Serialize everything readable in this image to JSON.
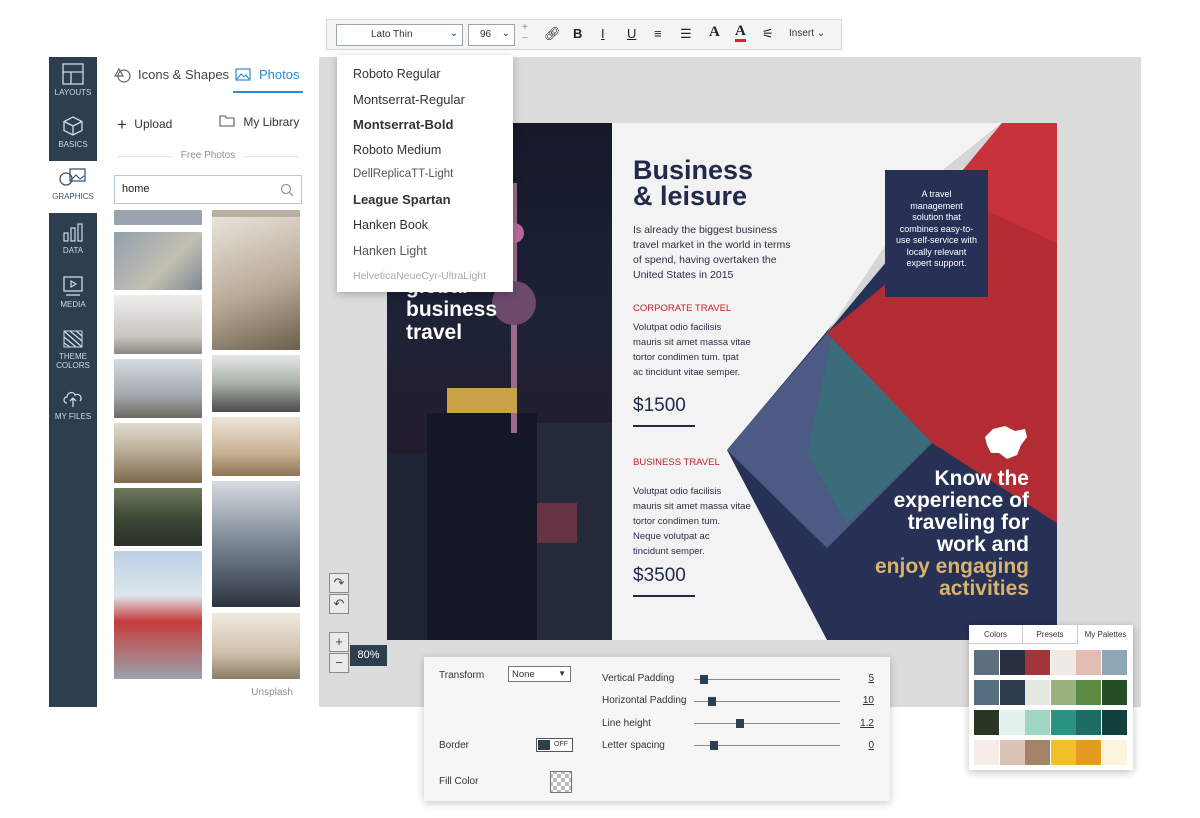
{
  "sidebar": {
    "items": [
      {
        "label": "LAYOUTS",
        "icon": "layouts-icon"
      },
      {
        "label": "BASICS",
        "icon": "cube-icon"
      },
      {
        "label": "GRAPHICS",
        "icon": "graphics-icon"
      },
      {
        "label": "DATA",
        "icon": "chart-icon"
      },
      {
        "label": "MEDIA",
        "icon": "media-icon"
      },
      {
        "label": "THEME",
        "label2": "COLORS",
        "icon": "theme-colors-icon"
      },
      {
        "label": "MY FILES",
        "icon": "cloud-upload-icon"
      }
    ]
  },
  "panel": {
    "tab_shapes": "Icons & Shapes",
    "tab_photos": "Photos",
    "upload_label": "Upload",
    "library_label": "My Library",
    "section_label": "Free Photos",
    "search_value": "home",
    "credit": "Unsplash"
  },
  "toolbar": {
    "font_value": "Lato Thin",
    "size_value": "96",
    "insert_label": "Insert"
  },
  "font_menu": [
    "Roboto Regular",
    "Montserrat-Regular",
    "Montserrat-Bold",
    "Roboto Medium",
    "DellReplicaTT-Light",
    "League Spartan",
    "Hanken Book",
    "Hanken Light",
    "HelveticaNeueCyr-UltraLight"
  ],
  "brochure": {
    "cover_line1": "global",
    "cover_line2": "business",
    "cover_line3": "travel",
    "title_line1": "Business",
    "title_line2": "& leisure",
    "intro": [
      "Is already the biggest business",
      "travel market in the world in terms",
      "of spend, having overtaken the",
      "United States in 2015"
    ],
    "section1_title": "CORPORATE TRAVEL",
    "section1_body": [
      "Volutpat odio facilisis",
      "mauris sit amet massa vitae",
      "tortor condimen tum. tpat",
      "ac tincidunt vitae semper."
    ],
    "price1": "$1500",
    "section2_title": "BUSINESS TRAVEL",
    "section2_body": [
      "Volutpat odio facilisis",
      "mauris sit amet massa vitae",
      "tortor condimen tum.",
      "Neque volutpat ac",
      "tincidunt semper."
    ],
    "price2": "$3500",
    "callout": [
      "A travel",
      "management",
      "solution that",
      "combines easy-to-",
      "use self-service with",
      "locally relevant",
      "expert support."
    ],
    "headline": [
      "Know the",
      "experience of",
      "traveling for",
      "work and"
    ],
    "headline_accent": [
      "enjoy engaging",
      "activities"
    ],
    "colors": {
      "navy": "#22294a",
      "red": "#c0232c",
      "gold": "#d9b36a"
    }
  },
  "zoom_level": "80%",
  "properties": {
    "transform_label": "Transform",
    "transform_value": "None",
    "border_label": "Border",
    "border_toggle": "OFF",
    "fill_label": "Fill Color",
    "vpad_label": "Vertical Padding",
    "vpad_value": "5",
    "hpad_label": "Horizontal Padding",
    "hpad_value": "10",
    "lh_label": "Line height",
    "lh_value": "1.2",
    "ls_label": "Letter spacing",
    "ls_value": "0"
  },
  "palettes": {
    "tabs": [
      "Colors",
      "Presets",
      "My Palettes"
    ],
    "rows": [
      [
        "#5f6f7e",
        "#2b3040",
        "#a1353b",
        "#f1ebe8",
        "#e2bdb4",
        "#8fa6b4"
      ],
      [
        "#566e80",
        "#2c3a4e",
        "#e5e8e2",
        "#9ab37c",
        "#5d8b46",
        "#264d25"
      ],
      [
        "#2a3524",
        "#e4f2ee",
        "#9fd6c2",
        "#2a9383",
        "#1d6d66",
        "#11403e"
      ],
      [
        "#f5ede6",
        "#dcc3b8",
        "#a28366",
        "#f3bf29",
        "#e59b22",
        "#fcf4dd"
      ]
    ]
  }
}
